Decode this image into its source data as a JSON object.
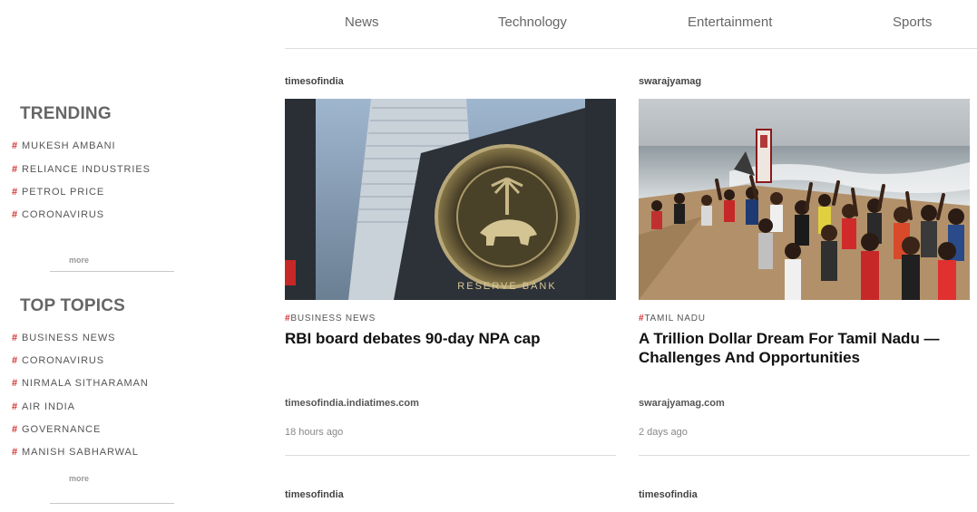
{
  "nav": {
    "items": [
      "News",
      "Technology",
      "Entertainment",
      "Sports"
    ]
  },
  "sidebar": {
    "trending": {
      "title": "TRENDING",
      "items": [
        "MUKESH AMBANI",
        "RELIANCE INDUSTRIES",
        "PETROL PRICE",
        "CORONAVIRUS"
      ],
      "more": "more"
    },
    "top_topics": {
      "title": "TOP TOPICS",
      "items": [
        "BUSINESS NEWS",
        "CORONAVIRUS",
        "NIRMALA SITHARAMAN",
        "AIR INDIA",
        "GOVERNANCE",
        "MANISH SABHARWAL"
      ],
      "more": "more"
    },
    "hash_symbol": "#"
  },
  "cards": [
    {
      "source": "timesofindia",
      "category": "BUSINESS NEWS",
      "headline": "RBI board debates 90-day NPA cap",
      "domain": "timesofindia.indiatimes.com",
      "time": "18 hours ago",
      "image_icon": "rbi-emblem-image"
    },
    {
      "source": "swarajyamag",
      "category": "TAMIL NADU",
      "headline": "A Trillion Dollar Dream For Tamil Nadu — Challenges And Opportunities",
      "domain": "swarajyamag.com",
      "time": "2 days ago",
      "image_icon": "beach-crowd-image"
    }
  ],
  "next_cards": [
    {
      "source": "timesofindia"
    },
    {
      "source": "timesofindia"
    }
  ],
  "colors": {
    "accent_hash": "#d32f2f",
    "divider": "#dedede"
  }
}
